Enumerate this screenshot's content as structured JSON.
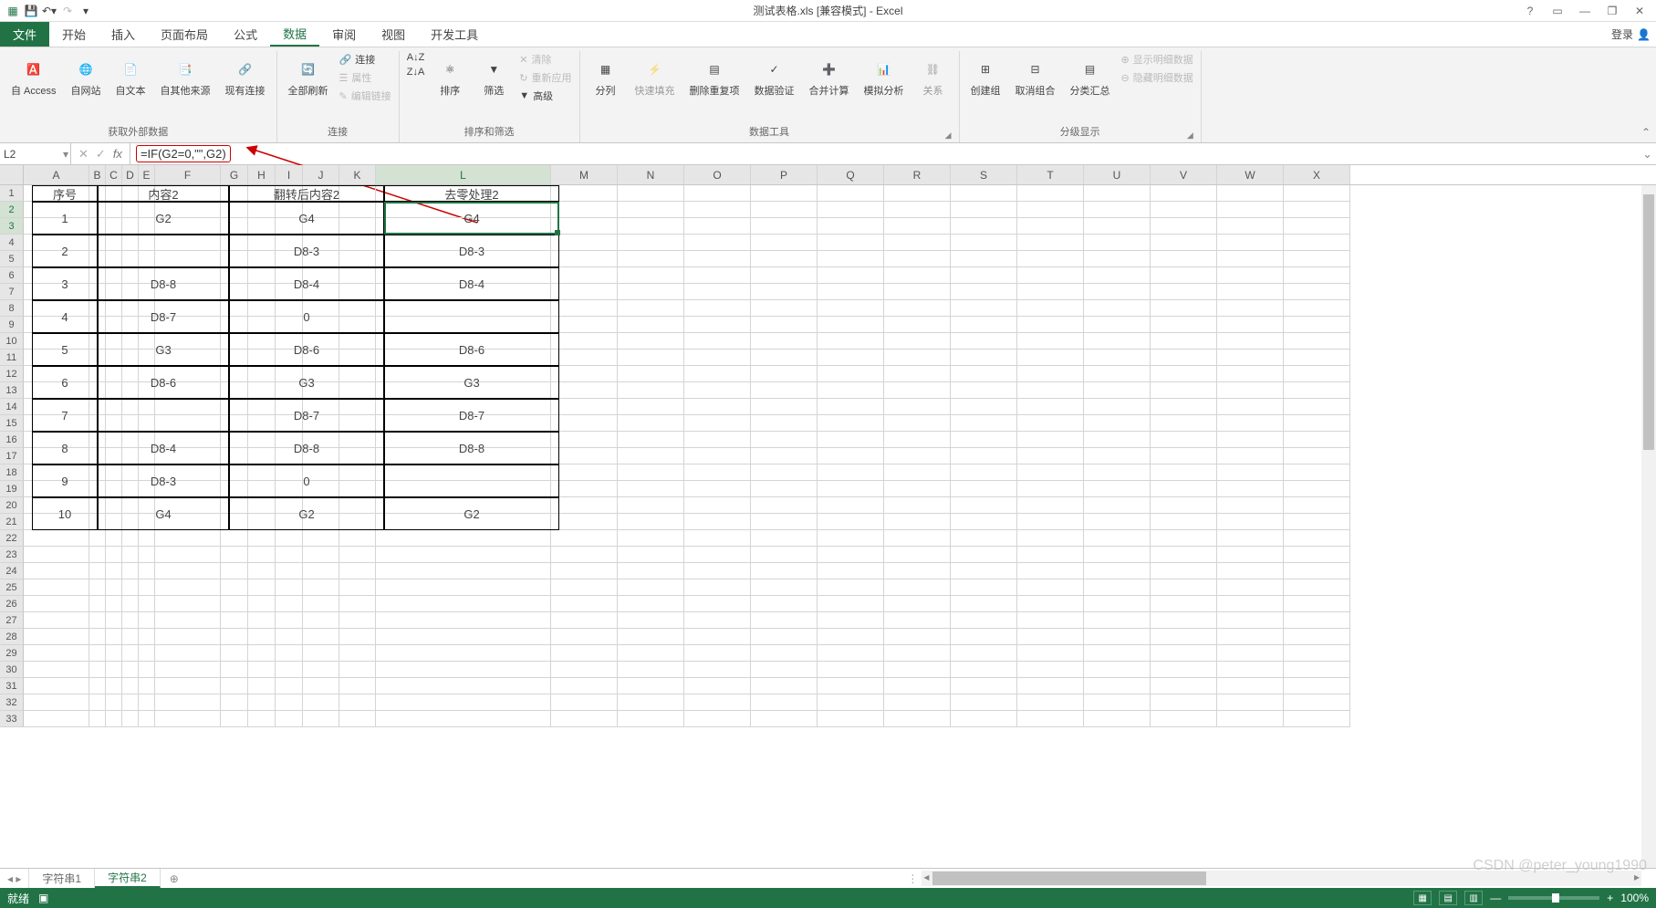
{
  "titlebar": {
    "title": "测试表格.xls [兼容模式] - Excel",
    "qat": [
      "excel-icon",
      "save-icon",
      "undo-icon",
      "redo-icon",
      "customize-icon"
    ]
  },
  "window_controls": {
    "help": "?",
    "ribbon_opts": "▭",
    "min": "—",
    "restore": "❐",
    "close": "✕"
  },
  "ribbon_tabs": {
    "file": "文件",
    "tabs": [
      "开始",
      "插入",
      "页面布局",
      "公式",
      "数据",
      "审阅",
      "视图",
      "开发工具"
    ],
    "active": "数据",
    "login": "登录"
  },
  "ribbon": {
    "get_external": {
      "label": "获取外部数据",
      "items": [
        "自 Access",
        "自网站",
        "自文本",
        "自其他来源",
        "现有连接"
      ]
    },
    "connections": {
      "label": "连接",
      "refresh": "全部刷新",
      "sub": [
        "连接",
        "属性",
        "编辑链接"
      ]
    },
    "sort_filter": {
      "label": "排序和筛选",
      "sort_asc": "A↓Z",
      "sort_desc": "Z↓A",
      "sort": "排序",
      "filter": "筛选",
      "sub": [
        "清除",
        "重新应用",
        "高级"
      ]
    },
    "data_tools": {
      "label": "数据工具",
      "items": [
        "分列",
        "快速填充",
        "删除重复项",
        "数据验证",
        "合并计算",
        "模拟分析",
        "关系"
      ]
    },
    "outline": {
      "label": "分级显示",
      "items": [
        "创建组",
        "取消组合",
        "分类汇总"
      ],
      "sub": [
        "显示明细数据",
        "隐藏明细数据"
      ]
    }
  },
  "formula_bar": {
    "namebox": "L2",
    "formula": "=IF(G2=0,\"\",G2)"
  },
  "columns": [
    "A",
    "B",
    "C",
    "D",
    "E",
    "F",
    "G",
    "H",
    "I",
    "J",
    "K",
    "L",
    "M",
    "N",
    "O",
    "P",
    "Q",
    "R",
    "S",
    "T",
    "U",
    "V",
    "W",
    "X"
  ],
  "col_widths_rest": 73,
  "row_count": 33,
  "active_cell": {
    "col": "L",
    "rows": [
      2,
      3
    ]
  },
  "table": {
    "col_widths": {
      "seq": 72,
      "c1": 144,
      "c2": 170,
      "c3": 192
    },
    "headers": [
      "序号",
      "内容2",
      "翻转后内容2",
      "去零处理2"
    ],
    "rows": [
      {
        "seq": "1",
        "c1": "G2",
        "c2": "G4",
        "c3": "G4"
      },
      {
        "seq": "2",
        "c1": "",
        "c2": "D8-3",
        "c3": "D8-3"
      },
      {
        "seq": "3",
        "c1": "D8-8",
        "c2": "D8-4",
        "c3": "D8-4"
      },
      {
        "seq": "4",
        "c1": "D8-7",
        "c2": "0",
        "c3": ""
      },
      {
        "seq": "5",
        "c1": "G3",
        "c2": "D8-6",
        "c3": "D8-6"
      },
      {
        "seq": "6",
        "c1": "D8-6",
        "c2": "G3",
        "c3": "G3"
      },
      {
        "seq": "7",
        "c1": "",
        "c2": "D8-7",
        "c3": "D8-7"
      },
      {
        "seq": "8",
        "c1": "D8-4",
        "c2": "D8-8",
        "c3": "D8-8"
      },
      {
        "seq": "9",
        "c1": "D8-3",
        "c2": "0",
        "c3": ""
      },
      {
        "seq": "10",
        "c1": "G4",
        "c2": "G2",
        "c3": "G2"
      }
    ]
  },
  "sheet_tabs": {
    "tabs": [
      "字符串1",
      "字符串2"
    ],
    "active": "字符串2"
  },
  "status": {
    "ready": "就绪",
    "zoom": "100%",
    "watermark": "CSDN @peter_young1990"
  },
  "colors": {
    "accent": "#217346"
  }
}
